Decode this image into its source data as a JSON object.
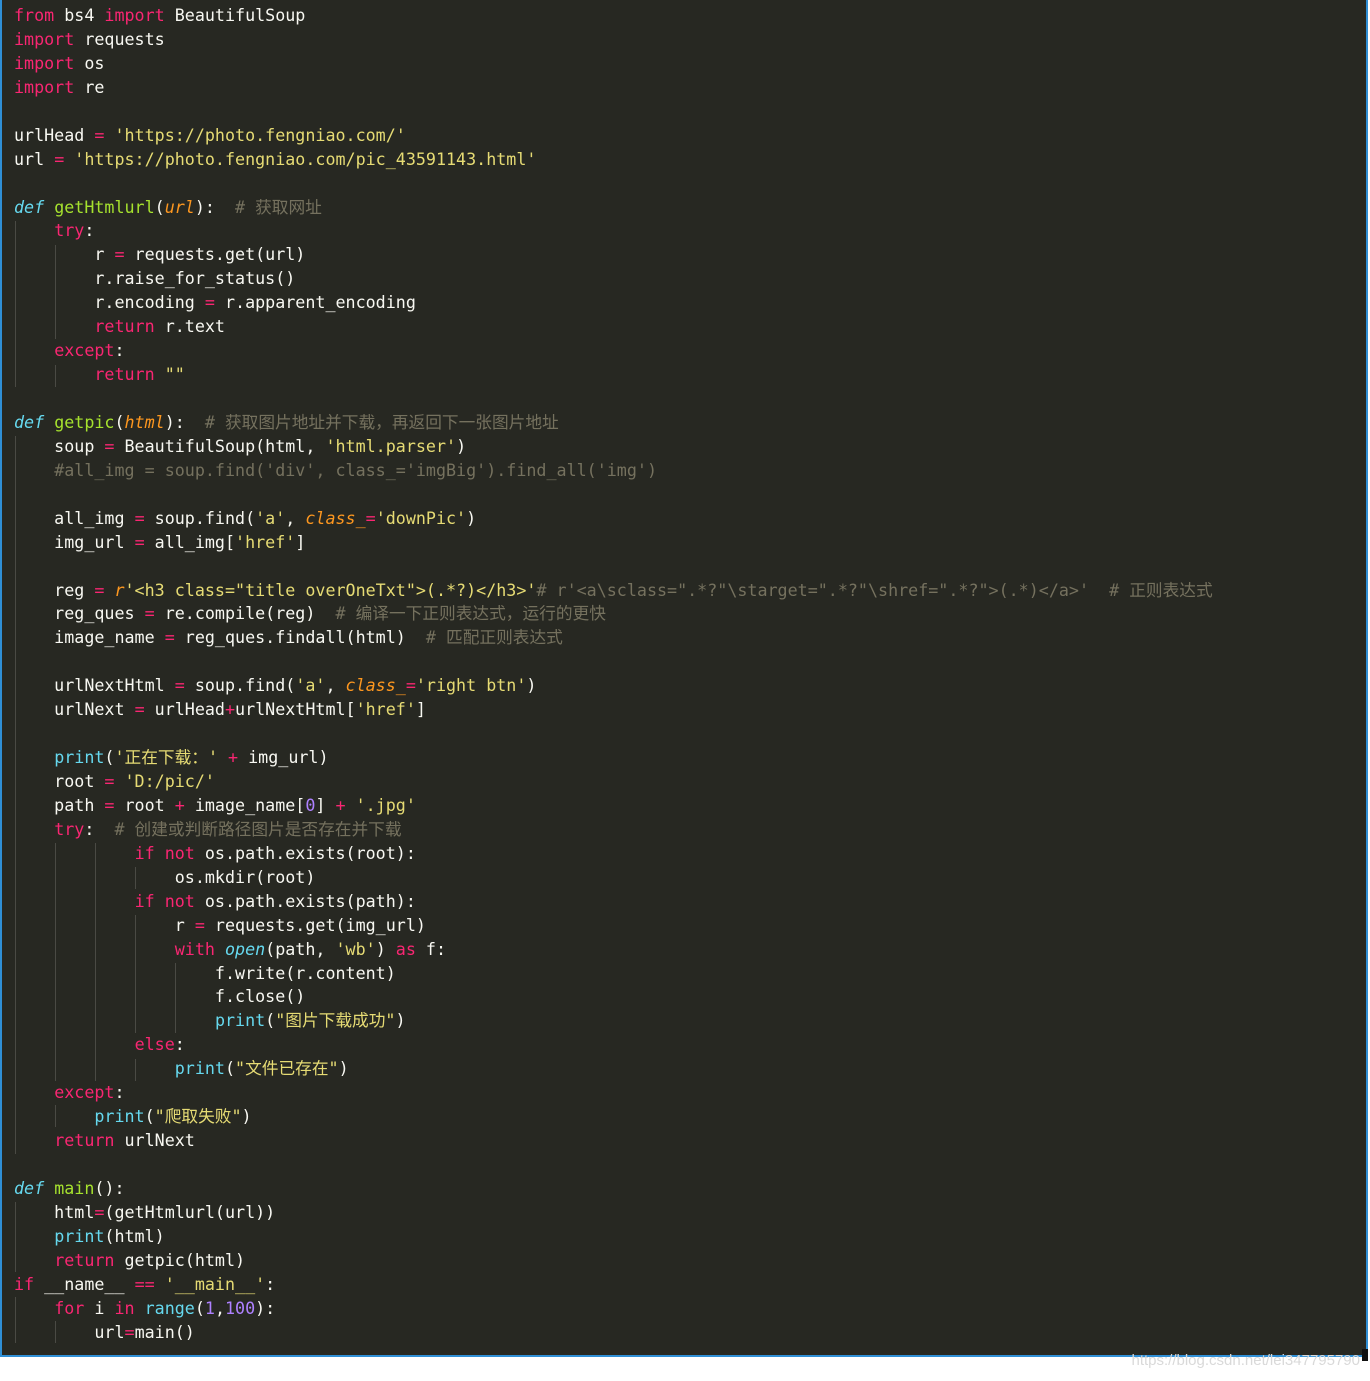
{
  "editor": {
    "lines": [
      [
        {
          "t": "from",
          "c": "kw"
        },
        {
          "t": " bs4 "
        },
        {
          "t": "import",
          "c": "kw"
        },
        {
          "t": " BeautifulSoup"
        }
      ],
      [
        {
          "t": "import",
          "c": "kw"
        },
        {
          "t": " requests"
        }
      ],
      [
        {
          "t": "import",
          "c": "kw"
        },
        {
          "t": " os"
        }
      ],
      [
        {
          "t": "import",
          "c": "kw"
        },
        {
          "t": " re"
        }
      ],
      [],
      [
        {
          "t": "urlHead "
        },
        {
          "t": "=",
          "c": "op"
        },
        {
          "t": " "
        },
        {
          "t": "'https://photo.fengniao.com/'",
          "c": "str"
        }
      ],
      [
        {
          "t": "url "
        },
        {
          "t": "=",
          "c": "op"
        },
        {
          "t": " "
        },
        {
          "t": "'https://photo.fengniao.com/pic_43591143.html'",
          "c": "str"
        }
      ],
      [],
      [
        {
          "t": "def",
          "c": "def"
        },
        {
          "t": " "
        },
        {
          "t": "getHtmlurl",
          "c": "fn"
        },
        {
          "t": "("
        },
        {
          "t": "url",
          "c": "par"
        },
        {
          "t": "):  "
        },
        {
          "t": "# 获取网址",
          "c": "cmt"
        }
      ],
      [
        {
          "t": "    "
        },
        {
          "t": "try",
          "c": "kw"
        },
        {
          "t": ":"
        }
      ],
      [
        {
          "t": "        r "
        },
        {
          "t": "=",
          "c": "op"
        },
        {
          "t": " requests.get(url)"
        }
      ],
      [
        {
          "t": "        r.raise_for_status()"
        }
      ],
      [
        {
          "t": "        r.encoding "
        },
        {
          "t": "=",
          "c": "op"
        },
        {
          "t": " r.apparent_encoding"
        }
      ],
      [
        {
          "t": "        "
        },
        {
          "t": "return",
          "c": "kw"
        },
        {
          "t": " r.text"
        }
      ],
      [
        {
          "t": "    "
        },
        {
          "t": "except",
          "c": "kw"
        },
        {
          "t": ":"
        }
      ],
      [
        {
          "t": "        "
        },
        {
          "t": "return",
          "c": "kw"
        },
        {
          "t": " "
        },
        {
          "t": "\"\"",
          "c": "str"
        }
      ],
      [],
      [
        {
          "t": "def",
          "c": "def"
        },
        {
          "t": " "
        },
        {
          "t": "getpic",
          "c": "fn"
        },
        {
          "t": "("
        },
        {
          "t": "html",
          "c": "par"
        },
        {
          "t": "):  "
        },
        {
          "t": "# 获取图片地址并下载，再返回下一张图片地址",
          "c": "cmt"
        }
      ],
      [
        {
          "t": "    soup "
        },
        {
          "t": "=",
          "c": "op"
        },
        {
          "t": " BeautifulSoup(html, "
        },
        {
          "t": "'html.parser'",
          "c": "str"
        },
        {
          "t": ")"
        }
      ],
      [
        {
          "t": "    "
        },
        {
          "t": "#all_img = soup.find('div', class_='imgBig').find_all('img')",
          "c": "cmt"
        }
      ],
      [],
      [
        {
          "t": "    all_img "
        },
        {
          "t": "=",
          "c": "op"
        },
        {
          "t": " soup.find("
        },
        {
          "t": "'a'",
          "c": "str"
        },
        {
          "t": ", "
        },
        {
          "t": "class_",
          "c": "par"
        },
        {
          "t": "=",
          "c": "op"
        },
        {
          "t": "'downPic'",
          "c": "str"
        },
        {
          "t": ")"
        }
      ],
      [
        {
          "t": "    img_url "
        },
        {
          "t": "=",
          "c": "op"
        },
        {
          "t": " all_img["
        },
        {
          "t": "'href'",
          "c": "str"
        },
        {
          "t": "]"
        }
      ],
      [],
      [
        {
          "t": "    reg "
        },
        {
          "t": "=",
          "c": "op"
        },
        {
          "t": " "
        },
        {
          "t": "r",
          "c": "par"
        },
        {
          "t": "'<h3 class=\"title overOneTxt\">(.*?)</h3>'",
          "c": "str"
        },
        {
          "t": "# r'<a\\sclass=\".*?\"\\starget=\".*?\"\\shref=\".*?\">(.*)</a>'  # 正则表达式",
          "c": "cmt"
        }
      ],
      [
        {
          "t": "    reg_ques "
        },
        {
          "t": "=",
          "c": "op"
        },
        {
          "t": " re.compile(reg)  "
        },
        {
          "t": "# 编译一下正则表达式，运行的更快",
          "c": "cmt"
        }
      ],
      [
        {
          "t": "    image_name "
        },
        {
          "t": "=",
          "c": "op"
        },
        {
          "t": " reg_ques.findall(html)  "
        },
        {
          "t": "# 匹配正则表达式",
          "c": "cmt"
        }
      ],
      [],
      [
        {
          "t": "    urlNextHtml "
        },
        {
          "t": "=",
          "c": "op"
        },
        {
          "t": " soup.find("
        },
        {
          "t": "'a'",
          "c": "str"
        },
        {
          "t": ", "
        },
        {
          "t": "class_",
          "c": "par"
        },
        {
          "t": "=",
          "c": "op"
        },
        {
          "t": "'right btn'",
          "c": "str"
        },
        {
          "t": ")"
        }
      ],
      [
        {
          "t": "    urlNext "
        },
        {
          "t": "=",
          "c": "op"
        },
        {
          "t": " urlHead"
        },
        {
          "t": "+",
          "c": "op"
        },
        {
          "t": "urlNextHtml["
        },
        {
          "t": "'href'",
          "c": "str"
        },
        {
          "t": "]"
        }
      ],
      [],
      [
        {
          "t": "    "
        },
        {
          "t": "print",
          "c": "bi"
        },
        {
          "t": "("
        },
        {
          "t": "'正在下载：'",
          "c": "str"
        },
        {
          "t": " "
        },
        {
          "t": "+",
          "c": "op"
        },
        {
          "t": " img_url)"
        }
      ],
      [
        {
          "t": "    root "
        },
        {
          "t": "=",
          "c": "op"
        },
        {
          "t": " "
        },
        {
          "t": "'D:/pic/'",
          "c": "str"
        }
      ],
      [
        {
          "t": "    path "
        },
        {
          "t": "=",
          "c": "op"
        },
        {
          "t": " root "
        },
        {
          "t": "+",
          "c": "op"
        },
        {
          "t": " image_name["
        },
        {
          "t": "0",
          "c": "num"
        },
        {
          "t": "] "
        },
        {
          "t": "+",
          "c": "op"
        },
        {
          "t": " "
        },
        {
          "t": "'.jpg'",
          "c": "str"
        }
      ],
      [
        {
          "t": "    "
        },
        {
          "t": "try",
          "c": "kw"
        },
        {
          "t": ":  "
        },
        {
          "t": "# 创建或判断路径图片是否存在并下载",
          "c": "cmt"
        }
      ],
      [
        {
          "t": "            "
        },
        {
          "t": "if",
          "c": "kw"
        },
        {
          "t": " "
        },
        {
          "t": "not",
          "c": "kw"
        },
        {
          "t": " os.path.exists(root):"
        }
      ],
      [
        {
          "t": "                os.mkdir(root)"
        }
      ],
      [
        {
          "t": "            "
        },
        {
          "t": "if",
          "c": "kw"
        },
        {
          "t": " "
        },
        {
          "t": "not",
          "c": "kw"
        },
        {
          "t": " os.path.exists(path):"
        }
      ],
      [
        {
          "t": "                r "
        },
        {
          "t": "=",
          "c": "op"
        },
        {
          "t": " requests.get(img_url)"
        }
      ],
      [
        {
          "t": "                "
        },
        {
          "t": "with",
          "c": "kw"
        },
        {
          "t": " "
        },
        {
          "t": "open",
          "c": "def"
        },
        {
          "t": "(path, "
        },
        {
          "t": "'wb'",
          "c": "str"
        },
        {
          "t": ") "
        },
        {
          "t": "as",
          "c": "kw"
        },
        {
          "t": " f:"
        }
      ],
      [
        {
          "t": "                    f.write(r.content)"
        }
      ],
      [
        {
          "t": "                    f.close()"
        }
      ],
      [
        {
          "t": "                    "
        },
        {
          "t": "print",
          "c": "bi"
        },
        {
          "t": "("
        },
        {
          "t": "\"图片下载成功\"",
          "c": "str"
        },
        {
          "t": ")"
        }
      ],
      [
        {
          "t": "            "
        },
        {
          "t": "else",
          "c": "kw"
        },
        {
          "t": ":"
        }
      ],
      [
        {
          "t": "                "
        },
        {
          "t": "print",
          "c": "bi"
        },
        {
          "t": "("
        },
        {
          "t": "\"文件已存在\"",
          "c": "str"
        },
        {
          "t": ")"
        }
      ],
      [
        {
          "t": "    "
        },
        {
          "t": "except",
          "c": "kw"
        },
        {
          "t": ":"
        }
      ],
      [
        {
          "t": "        "
        },
        {
          "t": "print",
          "c": "bi"
        },
        {
          "t": "("
        },
        {
          "t": "\"爬取失败\"",
          "c": "str"
        },
        {
          "t": ")"
        }
      ],
      [
        {
          "t": "    "
        },
        {
          "t": "return",
          "c": "kw"
        },
        {
          "t": " urlNext"
        }
      ],
      [],
      [
        {
          "t": "def",
          "c": "def"
        },
        {
          "t": " "
        },
        {
          "t": "main",
          "c": "fn"
        },
        {
          "t": "():"
        }
      ],
      [
        {
          "t": "    html"
        },
        {
          "t": "=",
          "c": "op"
        },
        {
          "t": "(getHtmlurl(url))"
        }
      ],
      [
        {
          "t": "    "
        },
        {
          "t": "print",
          "c": "bi"
        },
        {
          "t": "(html)"
        }
      ],
      [
        {
          "t": "    "
        },
        {
          "t": "return",
          "c": "kw"
        },
        {
          "t": " getpic(html)"
        }
      ],
      [
        {
          "t": "if",
          "c": "kw"
        },
        {
          "t": " __name__ "
        },
        {
          "t": "==",
          "c": "op"
        },
        {
          "t": " "
        },
        {
          "t": "'__main__'",
          "c": "str"
        },
        {
          "t": ":"
        }
      ],
      [
        {
          "t": "    "
        },
        {
          "t": "for",
          "c": "kw"
        },
        {
          "t": " i "
        },
        {
          "t": "in",
          "c": "kw"
        },
        {
          "t": " "
        },
        {
          "t": "range",
          "c": "bi"
        },
        {
          "t": "("
        },
        {
          "t": "1",
          "c": "num"
        },
        {
          "t": ","
        },
        {
          "t": "100",
          "c": "num"
        },
        {
          "t": "):"
        }
      ],
      [
        {
          "t": "        url"
        },
        {
          "t": "=",
          "c": "op"
        },
        {
          "t": "main()"
        }
      ]
    ]
  },
  "watermark": "https://blog.csdn.net/lei347795790",
  "colors": {
    "background": "#272822",
    "keyword": "#f92672",
    "function": "#a6e22e",
    "string": "#e6db74",
    "comment": "#75715e",
    "number": "#ae81ff",
    "builtin": "#66d9ef",
    "parameter": "#fd971f"
  }
}
